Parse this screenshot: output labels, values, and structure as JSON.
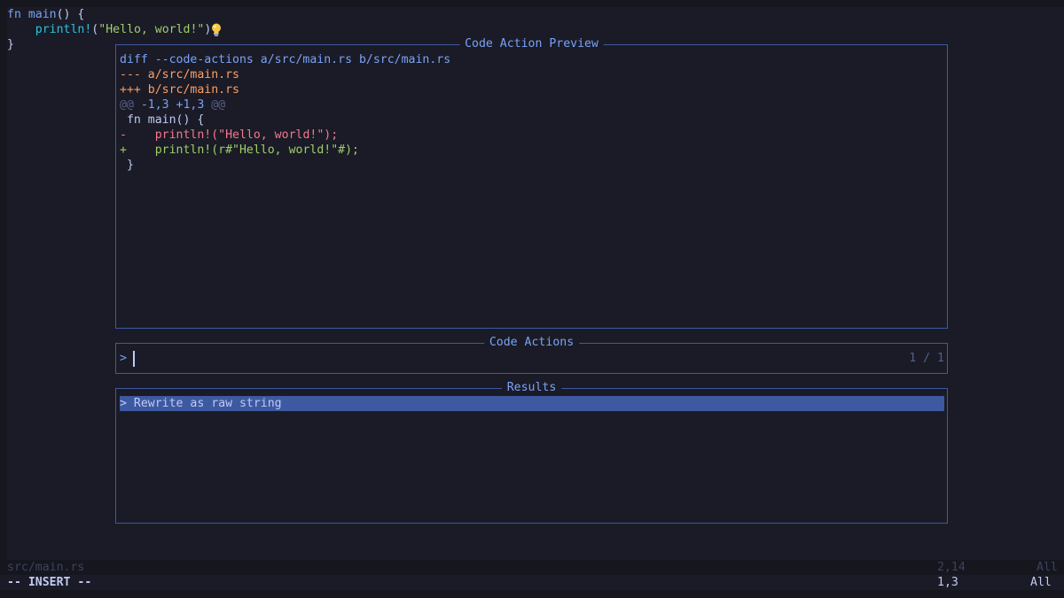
{
  "buffer": {
    "line1": {
      "kw": "fn",
      "fn": "main",
      "rest": "() {"
    },
    "line2": {
      "mac": "println!",
      "open": "(",
      "str": "\"Hello, world!\"",
      "close": ");"
    },
    "line3": "}",
    "lightbulb_icon": "lightbulb-icon"
  },
  "preview": {
    "title": "Code Action Preview",
    "diff_header": "diff --code-actions a/src/main.rs b/src/main.rs",
    "old_file": "--- a/src/main.rs",
    "new_file": "+++ b/src/main.rs",
    "hunk_marker_open": "@@",
    "hunk_range": " -1,3 +1,3 ",
    "hunk_marker_close": "@@",
    "context1": " fn main() {",
    "del_sign": "-",
    "del_text": "    println!(\"Hello, world!\");",
    "add_sign": "+",
    "add_text": "    println!(r#\"Hello, world!\"#);",
    "context2": " }"
  },
  "code_actions": {
    "title": "Code Actions",
    "prompt": ">",
    "counter": "1 / 1"
  },
  "results": {
    "title": "Results",
    "items": [
      "> Rewrite as raw string"
    ]
  },
  "statusline": {
    "filename": "src/main.rs",
    "position": "2,14",
    "scroll": "All"
  },
  "modeline": {
    "mode": "-- INSERT --",
    "position": "1,3",
    "scroll": "All"
  },
  "colors": {
    "background": "#1a1b26",
    "border": "#3d59a1",
    "accent": "#7aa2f7",
    "selection": "#3d59a1",
    "deleted": "#f7768e",
    "added": "#9ece6a",
    "file_header": "#ff9e64"
  }
}
